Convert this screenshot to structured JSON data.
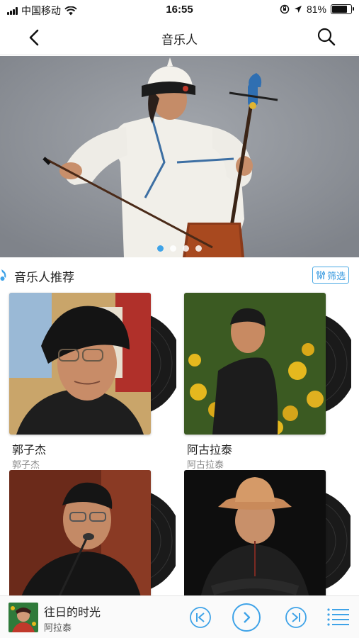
{
  "status_bar": {
    "carrier": "中国移动",
    "time": "16:55",
    "battery_text": "81%",
    "battery_level": 0.81,
    "icons": [
      "signal-icon",
      "wifi-icon",
      "orientation-lock-icon",
      "location-icon",
      "battery-icon"
    ]
  },
  "nav": {
    "title": "音乐人",
    "back_icon": "chevron-left-icon",
    "search_icon": "search-icon"
  },
  "banner": {
    "slide_count": 4,
    "active_index": 0
  },
  "section": {
    "title": "音乐人推荐",
    "filter_label": "筛选",
    "filter_icon": "filter-sliders-icon"
  },
  "artists": [
    {
      "name": "郭子杰",
      "sub": "郭子杰"
    },
    {
      "name": "阿古拉泰",
      "sub": "阿古拉泰"
    },
    {
      "name": "",
      "sub": ""
    },
    {
      "name": "",
      "sub": ""
    }
  ],
  "player": {
    "title": "往日的时光",
    "artist": "阿拉泰",
    "controls": [
      "previous-icon",
      "play-icon",
      "next-icon",
      "playlist-icon"
    ]
  },
  "colors": {
    "accent": "#3fa3e8",
    "banner_bg": "#8e9299"
  }
}
